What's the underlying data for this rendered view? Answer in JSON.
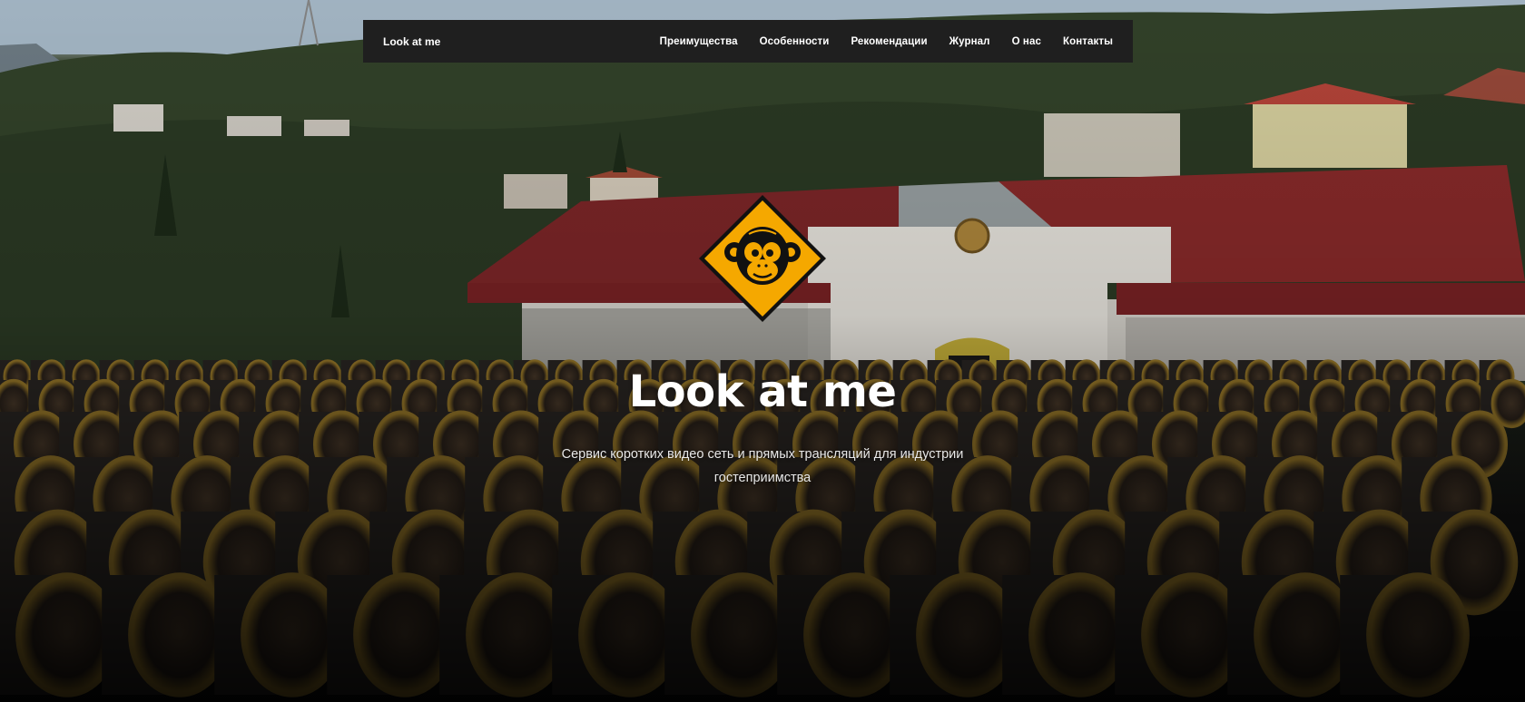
{
  "navbar": {
    "brand": "Look at me",
    "links": [
      {
        "label": "Преимущества"
      },
      {
        "label": "Особенности"
      },
      {
        "label": "Рекомендации"
      },
      {
        "label": "Журнал"
      },
      {
        "label": "О нас"
      },
      {
        "label": "Контакты"
      }
    ]
  },
  "hero": {
    "logo_icon": "monkey-warning-sign-icon",
    "title": "Look at me",
    "subtitle": "Сервис коротких видео сеть и прямых трансляций для индустрии гостеприимства",
    "background": "winery-barrels-photo"
  },
  "colors": {
    "navbar_bg": "#1f1f1f",
    "logo_fill": "#f5a800",
    "logo_border": "#111111",
    "roof": "#8a2a2a",
    "wall": "#e9e6df"
  }
}
